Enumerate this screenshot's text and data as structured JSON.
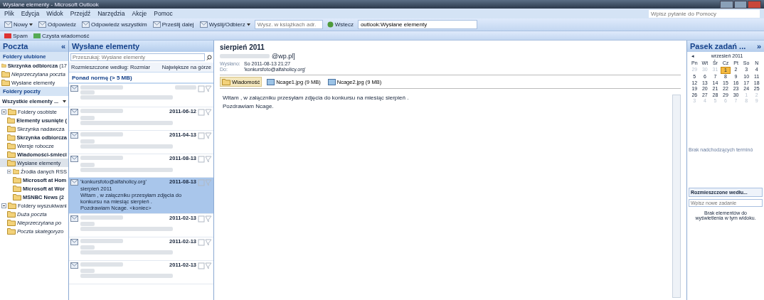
{
  "window": {
    "title": "Wysłane elementy - Microsoft Outlook",
    "help_placeholder": "Wpisz pytanie do Pomocy"
  },
  "menu": [
    "Plik",
    "Edycja",
    "Widok",
    "Przejdź",
    "Narzędzia",
    "Akcje",
    "Pomoc"
  ],
  "toolbar": {
    "new": "Nowy",
    "reply": "Odpowiedz",
    "reply_all": "Odpowiedz wszystkim",
    "forward": "Prześlij dalej",
    "send_receive": "Wyślij/Odbierz",
    "address_search_placeholder": "Wysz. w książkach adr.",
    "back": "Wstecz",
    "address": "outlook:Wysłane elementy"
  },
  "toolbar2": {
    "spam": "Spam",
    "clean": "Czysta wiadomość"
  },
  "nav": {
    "title": "Poczta",
    "collapse": "«",
    "favorites_title": "Foldery ulubione",
    "favorites": [
      {
        "label": "Skrzynka odbiorcza",
        "count": "(17",
        "bold": true,
        "italic": false,
        "selected": false
      },
      {
        "label": "Nieprzeczytana poczta",
        "bold": false,
        "italic": true,
        "selected": false
      },
      {
        "label": "Wysłane elementy",
        "bold": false,
        "italic": false,
        "selected": false
      }
    ],
    "mail_title": "Foldery poczty",
    "view_select": "Wszystkie elementy ...",
    "tree": [
      {
        "label": "Foldery osobiste",
        "bold": false,
        "italic": false,
        "selected": false,
        "children": [
          {
            "label": "Elementy usunięte (",
            "bold": true,
            "italic": false,
            "selected": false
          },
          {
            "label": "Skrzynka nadawcza",
            "bold": false,
            "italic": false,
            "selected": false
          },
          {
            "label": "Skrzynka odbiorcza",
            "bold": true,
            "italic": false,
            "selected": false
          },
          {
            "label": "Wersje robocze",
            "bold": false,
            "italic": false,
            "selected": false
          },
          {
            "label": "Wiadomości-śmieci",
            "bold": true,
            "italic": false,
            "selected": false
          },
          {
            "label": "Wysłane elementy",
            "bold": false,
            "italic": false,
            "selected": true
          },
          {
            "label": "Źródła danych RSS",
            "bold": false,
            "italic": false,
            "selected": false,
            "children": [
              {
                "label": "Microsoft at Hom",
                "bold": true,
                "italic": false,
                "selected": false
              },
              {
                "label": "Microsoft at Wor",
                "bold": true,
                "italic": false,
                "selected": false
              },
              {
                "label": "MSNBC News (2",
                "bold": true,
                "italic": false,
                "selected": false
              }
            ]
          }
        ]
      },
      {
        "label": "Foldery wyszukiwani",
        "bold": false,
        "italic": false,
        "selected": false,
        "children": [
          {
            "label": "Duża poczta",
            "bold": false,
            "italic": true,
            "selected": false
          },
          {
            "label": "Nieprzeczytana po",
            "bold": false,
            "italic": true,
            "selected": false
          },
          {
            "label": "Poczta skategoryzo",
            "bold": false,
            "italic": true,
            "selected": false
          }
        ]
      }
    ]
  },
  "list": {
    "title": "Wysłane elementy",
    "search_placeholder": "Przeszukaj: Wysłane elementy",
    "sort_by": "Rozmieszczone według: Rozmiar",
    "sort_order": "Największe na górze",
    "group": "Ponad normę (> 5 MB)",
    "rows": [
      {
        "selected": false
      },
      {
        "date": "2011-06-12",
        "selected": false
      },
      {
        "date": "2011-04-13",
        "selected": false
      },
      {
        "date": "2011-08-13",
        "selected": false
      },
      {
        "sender": "'konkursfoto@alfaholicy.org'",
        "date": "2011-08-13",
        "subject": "sierpień 2011",
        "preview": "Witam , w załączniku przesyłam zdjęcia do konkursu na miesiąc sierpień .",
        "ending": "Pozdrawiam Ncage. <koniec>",
        "selected": true
      },
      {
        "date": "2011-02-13",
        "selected": false
      },
      {
        "date": "2011-02-13",
        "selected": false
      },
      {
        "date": "2011-02-13",
        "selected": false
      }
    ]
  },
  "reading": {
    "subject": "sierpień 2011",
    "from": "@wp.pl]",
    "sent_label": "Wysłano:",
    "sent": "So 2011-08-13 21:27",
    "to_label": "Do:",
    "to": "'konkursfoto@alfaholicy.org'",
    "attachments": [
      {
        "label": "Wiadomość",
        "kind": "message",
        "selected": true
      },
      {
        "label": "Ncage1.jpg (9 MB)",
        "kind": "image",
        "selected": false
      },
      {
        "label": "Ncage2.jpg (9 MB)",
        "kind": "image",
        "selected": false
      }
    ],
    "body": [
      "Witam , w załączniku przesyłam zdjęcia do konkursu na miesiąc sierpień .",
      "Pozdrawiam Ncage."
    ]
  },
  "todo": {
    "title": "Pasek zadań ...",
    "expand": "»",
    "prev": "◂",
    "month": "wrzesień 2011",
    "weekdays": [
      "Pn",
      "Wt",
      "Śr",
      "Cz",
      "Pt",
      "So",
      "N"
    ],
    "days": [
      {
        "d": "29",
        "other": true,
        "today": false
      },
      {
        "d": "30",
        "other": true,
        "today": false
      },
      {
        "d": "31",
        "other": true,
        "today": false
      },
      {
        "d": "1",
        "other": false,
        "today": true
      },
      {
        "d": "2",
        "other": false,
        "today": false
      },
      {
        "d": "3",
        "other": false,
        "today": false
      },
      {
        "d": "4",
        "other": false,
        "today": false
      },
      {
        "d": "5",
        "other": false,
        "today": false
      },
      {
        "d": "6",
        "other": false,
        "today": false
      },
      {
        "d": "7",
        "other": false,
        "today": false
      },
      {
        "d": "8",
        "other": false,
        "today": false
      },
      {
        "d": "9",
        "other": false,
        "today": false
      },
      {
        "d": "10",
        "other": false,
        "today": false
      },
      {
        "d": "11",
        "other": false,
        "today": false
      },
      {
        "d": "12",
        "other": false,
        "today": false
      },
      {
        "d": "13",
        "other": false,
        "today": false
      },
      {
        "d": "14",
        "other": false,
        "today": false
      },
      {
        "d": "15",
        "other": false,
        "today": false
      },
      {
        "d": "16",
        "other": false,
        "today": false
      },
      {
        "d": "17",
        "other": false,
        "today": false
      },
      {
        "d": "18",
        "other": false,
        "today": false
      },
      {
        "d": "19",
        "other": false,
        "today": false
      },
      {
        "d": "20",
        "other": false,
        "today": false
      },
      {
        "d": "21",
        "other": false,
        "today": false
      },
      {
        "d": "22",
        "other": false,
        "today": false
      },
      {
        "d": "23",
        "other": false,
        "today": false
      },
      {
        "d": "24",
        "other": false,
        "today": false
      },
      {
        "d": "25",
        "other": false,
        "today": false
      },
      {
        "d": "26",
        "other": false,
        "today": false
      },
      {
        "d": "27",
        "other": false,
        "today": false
      },
      {
        "d": "28",
        "other": false,
        "today": false
      },
      {
        "d": "29",
        "other": false,
        "today": false
      },
      {
        "d": "30",
        "other": false,
        "today": false
      },
      {
        "d": "1",
        "other": true,
        "today": false
      },
      {
        "d": "2",
        "other": true,
        "today": false
      },
      {
        "d": "3",
        "other": true,
        "today": false
      },
      {
        "d": "4",
        "other": true,
        "today": false
      },
      {
        "d": "5",
        "other": true,
        "today": false
      },
      {
        "d": "6",
        "other": true,
        "today": false
      },
      {
        "d": "7",
        "other": true,
        "today": false
      },
      {
        "d": "8",
        "other": true,
        "today": false
      },
      {
        "d": "9",
        "other": true,
        "today": false
      }
    ],
    "no_appointments": "Brak nadchodzących terminó",
    "task_sort": "Rozmieszczone wedłu...",
    "task_placeholder": "Wpisz nowe zadanie",
    "no_tasks": "Brak elementów do wyświetlenia w tym widoku."
  }
}
